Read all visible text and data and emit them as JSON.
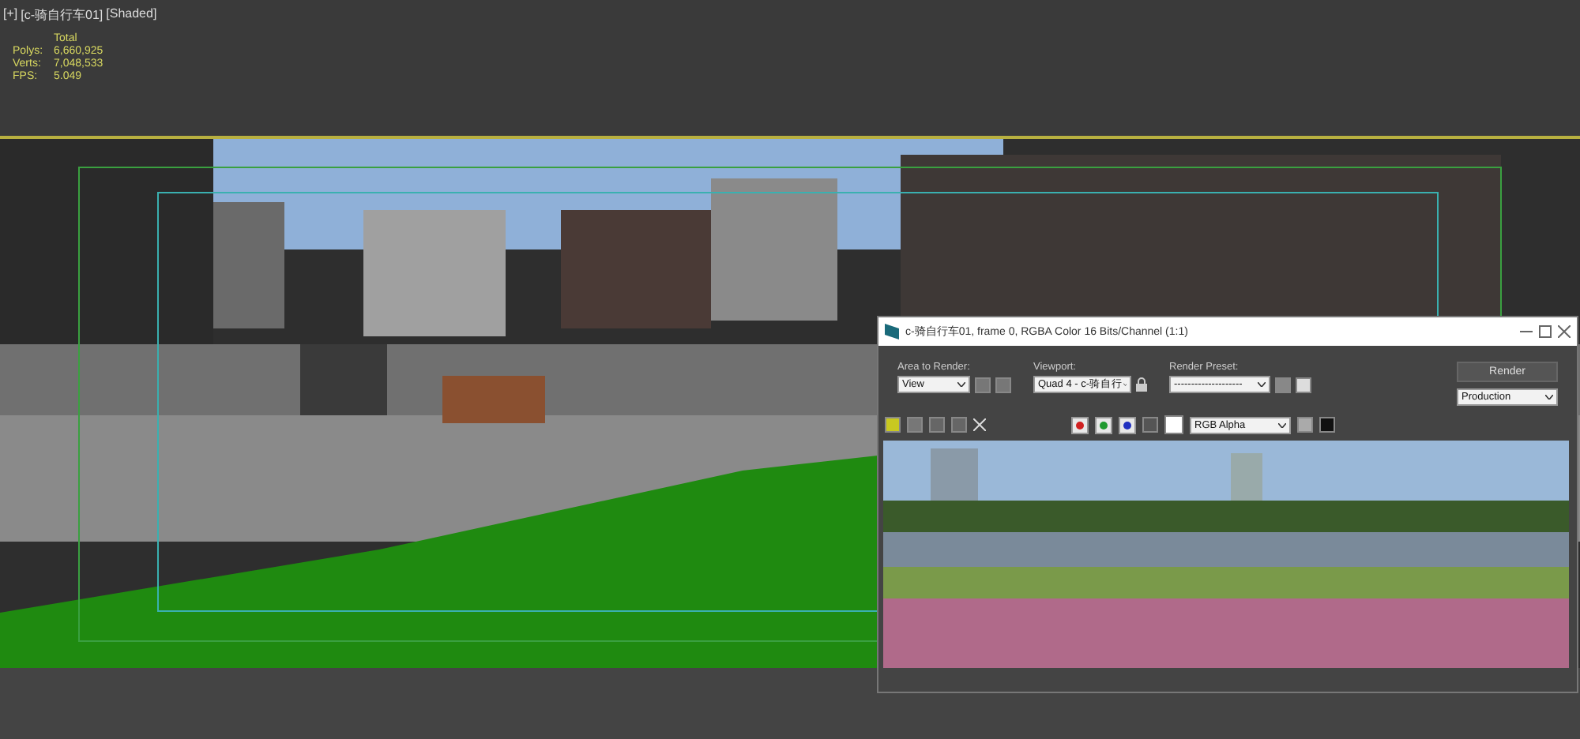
{
  "viewport": {
    "labels": [
      "[+]",
      "[c-骑自行车01]",
      "[Shaded]"
    ],
    "stats": {
      "header": "Total",
      "rows": [
        {
          "label": "Polys:",
          "value": "6,660,925"
        },
        {
          "label": "Verts:",
          "value": "7,048,533"
        },
        {
          "label": "FPS:",
          "value": "5.049"
        }
      ]
    }
  },
  "render_window": {
    "title": "c-骑自行车01, frame 0, RGBA Color 16 Bits/Channel (1:1)",
    "area": {
      "label": "Area to Render:",
      "value": "View"
    },
    "viewport": {
      "label": "Viewport:",
      "value": "Quad 4 - c-骑自行"
    },
    "preset": {
      "label": "Render Preset:",
      "value": "--------------------"
    },
    "render_button": "Render",
    "mode": "Production",
    "channels": [
      {
        "color": "#d02020",
        "checked": true
      },
      {
        "color": "#1f9a2f",
        "checked": true
      },
      {
        "color": "#2030c0",
        "checked": true
      }
    ],
    "display": "RGB Alpha"
  }
}
